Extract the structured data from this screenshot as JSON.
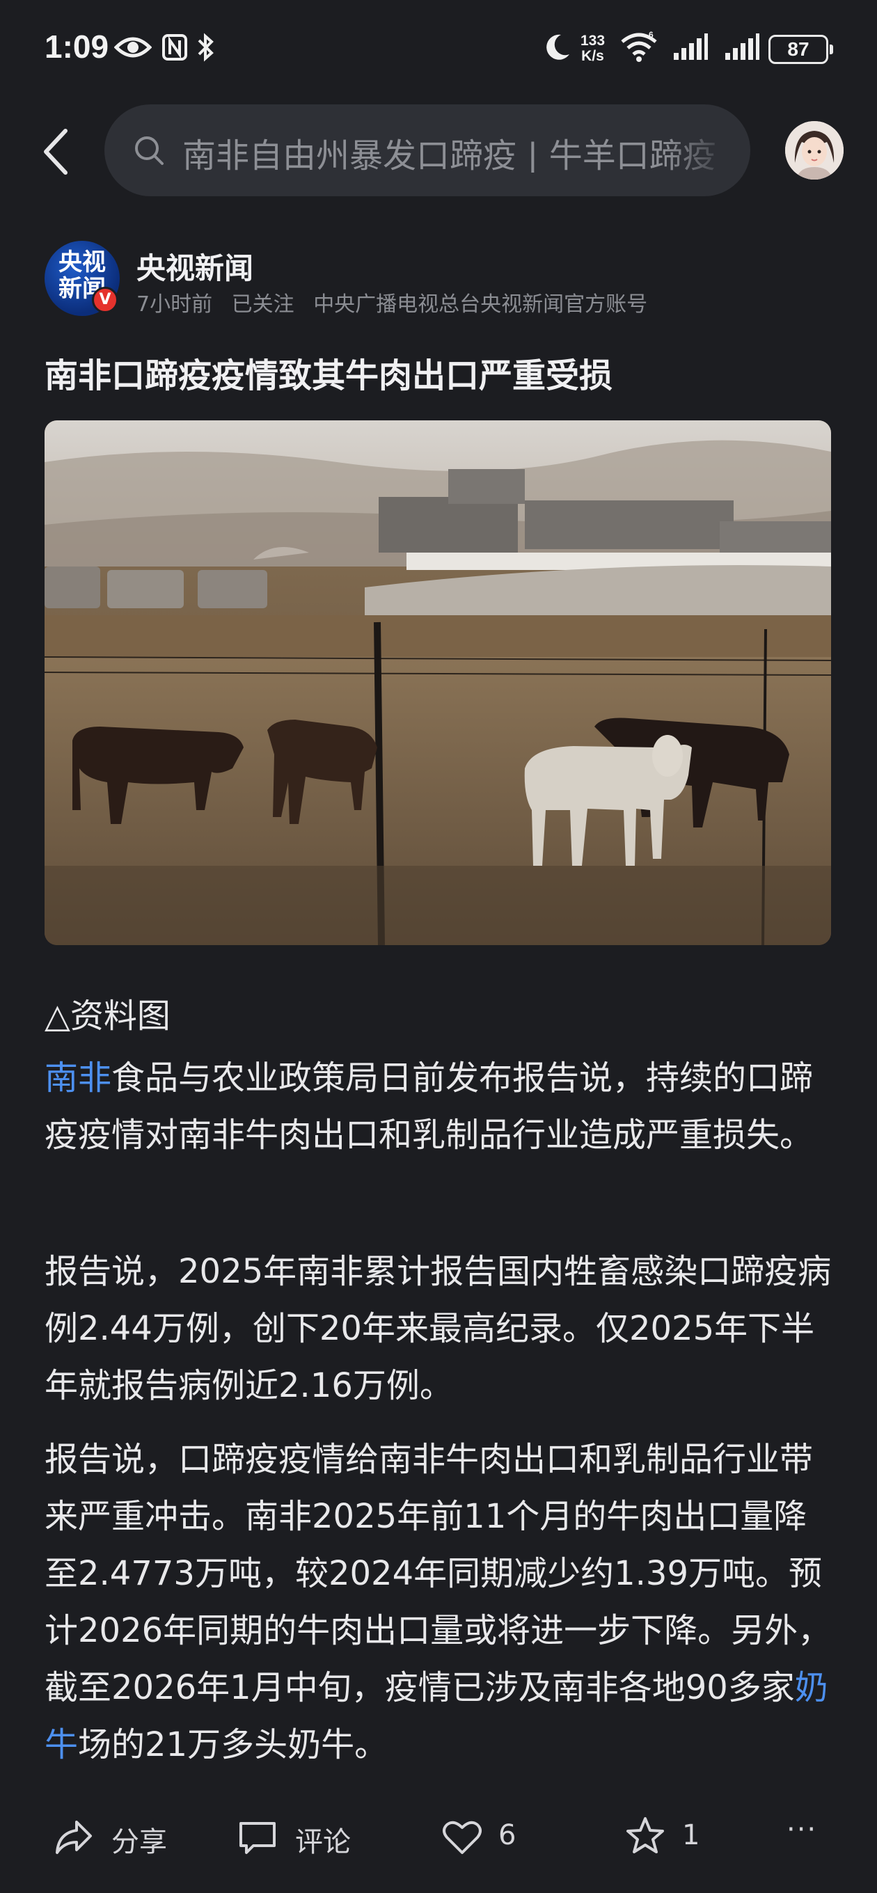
{
  "status_bar": {
    "time": "1:09",
    "network_speed_value": "133",
    "network_speed_unit": "K/s",
    "battery": "87",
    "icons": [
      "eye-icon",
      "nfc-icon",
      "bluetooth-icon",
      "moon-icon",
      "wifi-icon",
      "signal-icon",
      "signal-icon",
      "battery-icon"
    ]
  },
  "top_bar": {
    "search_text": "南非自由州暴发口蹄疫 | 牛羊口蹄疫"
  },
  "author": {
    "logo_line1": "央视",
    "logo_line2": "新闻",
    "verified": "V",
    "name": "央视新闻",
    "time": "7小时前",
    "follow_status": "已关注",
    "description": "中央广播电视总台央视新闻官方账号"
  },
  "article": {
    "title": "南非口蹄疫疫情致其牛肉出口严重受损",
    "caption": "△资料图",
    "p1_link": "南非",
    "p1_text": "食品与农业政策局日前发布报告说，持续的口蹄疫疫情对南非牛肉出口和乳制品行业造成严重损失。",
    "p2_text": "报告说，2025年南非累计报告国内牲畜感染口蹄疫病例2.44万例，创下20年来最高纪录。仅2025年下半年就报告病例近2.16万例。",
    "p3_text_a": "报告说，口蹄疫疫情给南非牛肉出口和乳制品行业带来严重冲击。南非2025年前11个月的牛肉出口量降至2.4773万吨，较2024年同期减少约1.39万吨。预计2026年同期的牛肉出口量或将进一步下降。另外，截至2026年1月中旬，疫情已涉及南非各地90多家",
    "p3_link": "奶牛",
    "p3_text_b": "场的21万多头奶牛。"
  },
  "bottom_bar": {
    "share_label": "分享",
    "comment_label": "评论",
    "like_count": "6",
    "star_count": "1",
    "more_label": "···"
  }
}
